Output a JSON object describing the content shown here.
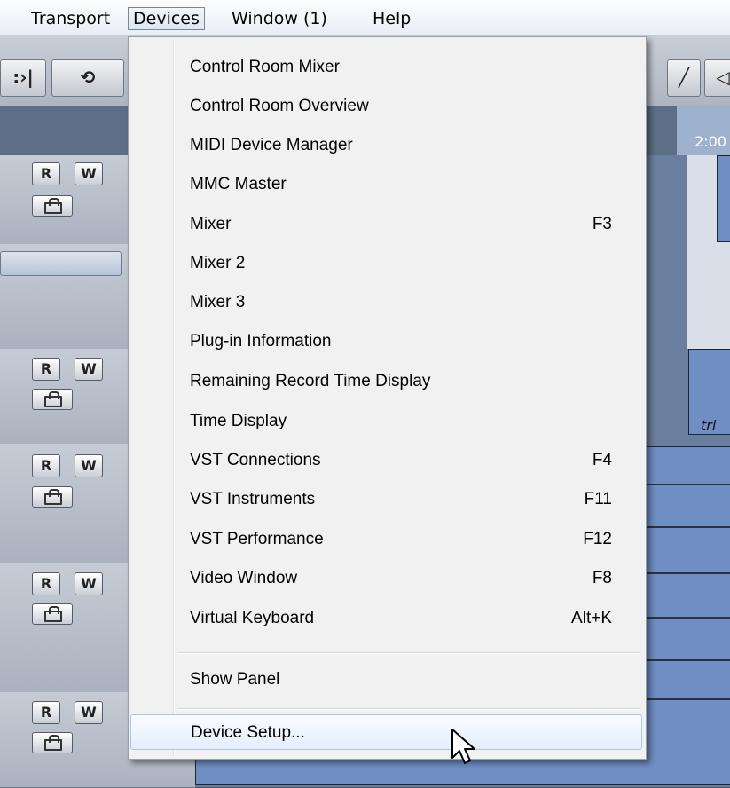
{
  "menubar": {
    "items": [
      {
        "label": "Transport"
      },
      {
        "label": "Devices"
      },
      {
        "label": "Window (1)"
      },
      {
        "label": "Help"
      }
    ]
  },
  "background": {
    "ruler_label": "2:00",
    "track_buttons": {
      "read": "R",
      "write": "W"
    },
    "clip_label": "tri"
  },
  "devices_menu": {
    "items": [
      {
        "label": "Control Room Mixer",
        "shortcut": ""
      },
      {
        "label": "Control Room Overview",
        "shortcut": ""
      },
      {
        "label": "MIDI Device Manager",
        "shortcut": ""
      },
      {
        "label": "MMC Master",
        "shortcut": ""
      },
      {
        "label": "Mixer",
        "shortcut": "F3"
      },
      {
        "label": "Mixer 2",
        "shortcut": ""
      },
      {
        "label": "Mixer 3",
        "shortcut": ""
      },
      {
        "label": "Plug-in Information",
        "shortcut": ""
      },
      {
        "label": "Remaining Record Time Display",
        "shortcut": ""
      },
      {
        "label": "Time Display",
        "shortcut": ""
      },
      {
        "label": "VST Connections",
        "shortcut": "F4"
      },
      {
        "label": "VST Instruments",
        "shortcut": "F11"
      },
      {
        "label": "VST Performance",
        "shortcut": "F12"
      },
      {
        "label": "Video Window",
        "shortcut": "F8"
      },
      {
        "label": "Virtual Keyboard",
        "shortcut": "Alt+K"
      }
    ],
    "show_panel": {
      "label": "Show Panel"
    },
    "device_setup": {
      "label": "Device Setup..."
    }
  }
}
